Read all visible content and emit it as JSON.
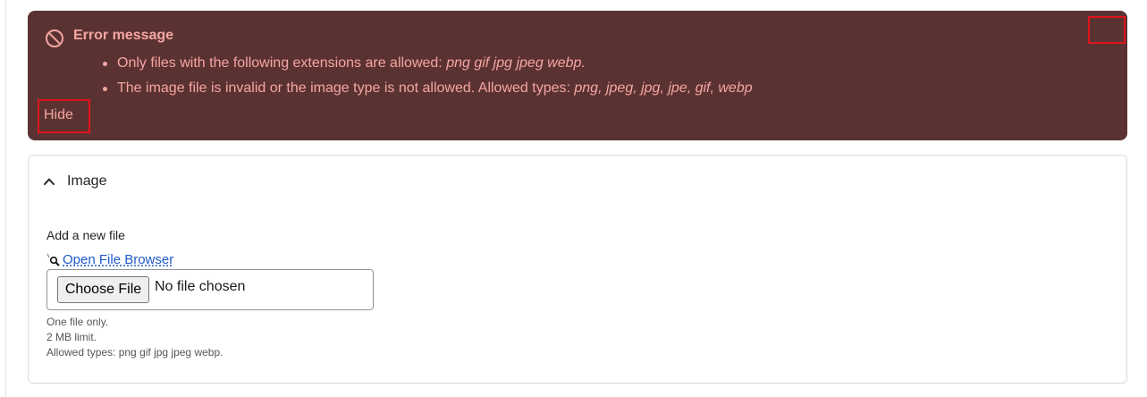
{
  "error": {
    "title": "Error message",
    "items": [
      {
        "text": "Only files with the following extensions are allowed: ",
        "emphasis": "png gif jpg jpeg webp",
        "suffix": "."
      },
      {
        "text": "The image file is invalid or the image type is not allowed. Allowed types: ",
        "emphasis": "png, jpeg, jpg, jpe, gif, webp",
        "suffix": ""
      }
    ],
    "hide_label": "Hide",
    "background_color": "#5b3232",
    "text_color": "#f4a6a1",
    "icon": "prohibited-icon"
  },
  "image_panel": {
    "title": "Image",
    "icon": "chevron-up-icon",
    "field_label": "Add a new file",
    "file_browser_label": "Open File Browser",
    "file_browser_icon": "magnifier-icon",
    "choose_file_label": "Choose File",
    "file_status": "No file chosen",
    "help": {
      "line1": "One file only.",
      "line2": "2 MB limit.",
      "line3": "Allowed types: png gif jpg jpeg webp."
    },
    "link_color": "#1f59c9"
  }
}
